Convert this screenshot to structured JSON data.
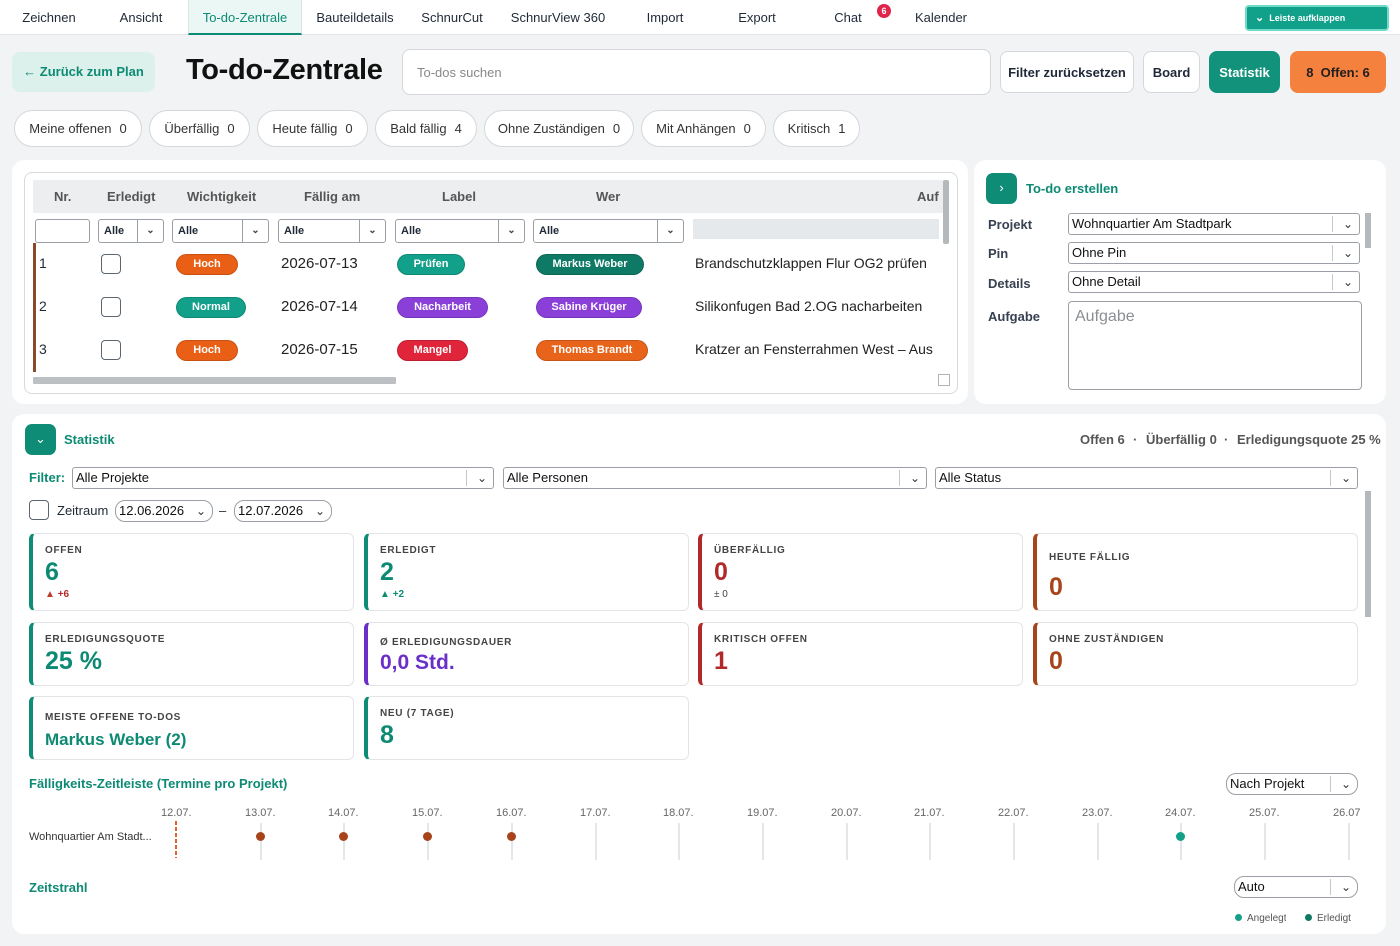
{
  "nav": {
    "tabs": [
      "Zeichnen",
      "Ansicht",
      "To-do-Zentrale",
      "Bauteildetails",
      "SchnurCut",
      "SchnurView 360",
      "Import",
      "Export",
      "Chat",
      "Kalender"
    ],
    "active_tab": "To-do-Zentrale",
    "chat_badge": "6",
    "leiste_label": "Leiste aufklappen"
  },
  "header": {
    "back_label": "Zurück zum Plan",
    "title": "To-do-Zentrale",
    "search_placeholder": "To-dos suchen",
    "reset_label": "Filter zurücksetzen",
    "board_label": "Board",
    "stats_label": "Statistik",
    "open_count": "8",
    "open_label": "Offen: 6"
  },
  "chips": [
    {
      "label": "Meine offenen",
      "count": "0"
    },
    {
      "label": "Überfällig",
      "count": "0"
    },
    {
      "label": "Heute fällig",
      "count": "0"
    },
    {
      "label": "Bald fällig",
      "count": "4"
    },
    {
      "label": "Ohne Zuständigen",
      "count": "0"
    },
    {
      "label": "Mit Anhängen",
      "count": "0"
    },
    {
      "label": "Kritisch",
      "count": "1"
    }
  ],
  "table": {
    "columns": [
      "Nr.",
      "Erledigt",
      "Wichtigkeit",
      "Fällig am",
      "Label",
      "Wer",
      "Auf"
    ],
    "filters": [
      "Alle",
      "Alle",
      "Alle",
      "Alle",
      "Alle"
    ],
    "rows": [
      {
        "nr": "1",
        "priority": "Hoch",
        "priority_color": "#ea5f16",
        "due": "2026-07-13",
        "label": "Prüfen",
        "label_color": "#12a08a",
        "who": "Markus Weber",
        "who_color": "#0e7a66",
        "task": "Brandschutzklappen Flur OG2 prüfen"
      },
      {
        "nr": "2",
        "priority": "Normal",
        "priority_color": "#12a08a",
        "due": "2026-07-14",
        "label": "Nacharbeit",
        "label_color": "#8b3fd9",
        "who": "Sabine Krüger",
        "who_color": "#8b3fd9",
        "task": "Silikonfugen Bad 2.OG nacharbeiten"
      },
      {
        "nr": "3",
        "priority": "Hoch",
        "priority_color": "#ea5f16",
        "due": "2026-07-15",
        "label": "Mangel",
        "label_color": "#e0243a",
        "who": "Thomas Brandt",
        "who_color": "#e8641a",
        "task": "Kratzer an Fensterrahmen West – Aus"
      }
    ]
  },
  "create": {
    "title": "To-do erstellen",
    "fields": [
      {
        "label": "Projekt",
        "value": "Wohnquartier Am Stadtpark"
      },
      {
        "label": "Pin",
        "value": "Ohne Pin"
      },
      {
        "label": "Details",
        "value": "Ohne Detail"
      }
    ],
    "task_label": "Aufgabe",
    "task_placeholder": "Aufgabe"
  },
  "stats": {
    "title": "Statistik",
    "summary": [
      "Offen 6",
      "Überfällig 0",
      "Erledigungsquote 25 %"
    ],
    "filter_label": "Filter:",
    "filters": [
      "Alle Projekte",
      "Alle Personen",
      "Alle Status"
    ],
    "zeitraum_label": "Zeitraum",
    "date_from": "12.06.2026",
    "date_sep": "–",
    "date_to": "12.07.2026",
    "cards": [
      {
        "label": "OFFEN",
        "value": "6",
        "delta": "+6",
        "color": "#0e8a74",
        "accent": "#0f8c76"
      },
      {
        "label": "ERLEDIGT",
        "value": "2",
        "delta": "+2",
        "color": "#0e8a74",
        "accent": "#0f8c76"
      },
      {
        "label": "ÜBERFÄLLIG",
        "value": "0",
        "delta": "± 0",
        "color": "#b02a2a",
        "accent": "#b02a2a"
      },
      {
        "label": "HEUTE FÄLLIG",
        "value": "0",
        "delta": "",
        "color": "#a8441c",
        "accent": "#a8441c"
      },
      {
        "label": "ERLEDIGUNGSQUOTE",
        "value": "25 %",
        "delta": "",
        "color": "#0e8a74",
        "accent": "#0f8c76"
      },
      {
        "label": "Ø ERLEDIGUNGSDAUER",
        "value": "0,0 Std.",
        "delta": "",
        "color": "#6b2fc9",
        "accent": "#6b2fc9"
      },
      {
        "label": "KRITISCH OFFEN",
        "value": "1",
        "delta": "",
        "color": "#b02a2a",
        "accent": "#b02a2a"
      },
      {
        "label": "OHNE ZUSTÄNDIGEN",
        "value": "0",
        "delta": "",
        "color": "#a8441c",
        "accent": "#a8441c"
      },
      {
        "label": "MEISTE OFFENE TO-DOS",
        "value": "Markus Weber (2)",
        "delta": "",
        "color": "#0e8a74",
        "accent": "#0f8c76"
      },
      {
        "label": "NEU (7 TAGE)",
        "value": "8",
        "delta": "",
        "color": "#0e8a74",
        "accent": "#0f8c76"
      }
    ],
    "timeline_title": "Fälligkeits-Zeitleiste (Termine pro Projekt)",
    "timeline_mode": "Nach Projekt",
    "timeline_dates": [
      "12.07.",
      "13.07.",
      "14.07.",
      "15.07.",
      "16.07.",
      "17.07.",
      "18.07.",
      "19.07.",
      "20.07.",
      "21.07.",
      "22.07.",
      "23.07.",
      "24.07.",
      "25.07.",
      "26.07"
    ],
    "timeline_project": "Wohnquartier Am Stadt...",
    "timeline_points": [
      {
        "date": "13.07.",
        "color": "#a8441c"
      },
      {
        "date": "14.07.",
        "color": "#a8441c"
      },
      {
        "date": "15.07.",
        "color": "#a8441c"
      },
      {
        "date": "16.07.",
        "color": "#a8441c"
      },
      {
        "date": "24.07.",
        "color": "#12a08a"
      }
    ],
    "zeitstrahl_title": "Zeitstrahl",
    "zeitstrahl_mode": "Auto",
    "legend": [
      {
        "label": "Angelegt",
        "color": "#12a08a"
      },
      {
        "label": "Erledigt",
        "color": "#0e7a66"
      }
    ]
  }
}
